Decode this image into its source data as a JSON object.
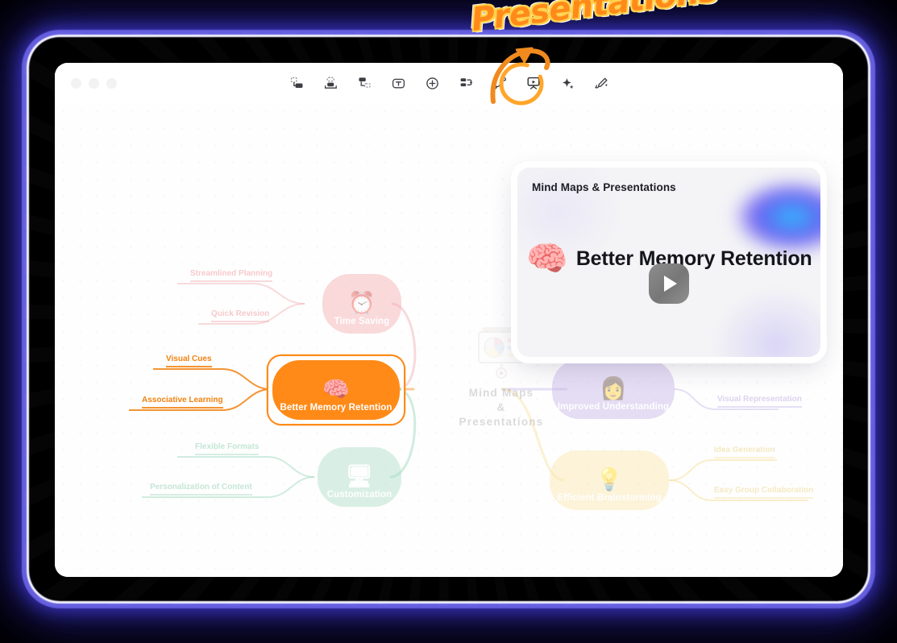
{
  "annotation": {
    "callout_text": "Presentations",
    "arrow": "curved-arrow-pointing-to-presentation-tool",
    "highlight_color": "#FF9B20"
  },
  "window": {
    "traffic_lights": [
      "close",
      "minimize",
      "maximize"
    ],
    "toolbar": {
      "items": [
        {
          "name": "layout-right-icon",
          "label": "Right Layout"
        },
        {
          "name": "layout-bottom-icon",
          "label": "Bottom Layout"
        },
        {
          "name": "tree-layout-icon",
          "label": "Tree Layout"
        },
        {
          "name": "text-icon",
          "label": "Text"
        },
        {
          "name": "add-node-icon",
          "label": "Add"
        },
        {
          "name": "outline-icon",
          "label": "Outline"
        },
        {
          "name": "relationship-icon",
          "label": "Relationship"
        },
        {
          "name": "presentation-icon",
          "label": "Presentation",
          "selected": true
        },
        {
          "name": "ai-sparkle-icon",
          "label": "AI Assistant"
        },
        {
          "name": "magic-brush-icon",
          "label": "Style Brush"
        }
      ]
    }
  },
  "presentation_card": {
    "title": "Mind Maps & Presentations",
    "slide_emoji": "brain-in-hands",
    "slide_heading": "Better Memory Retention",
    "play_button": "play"
  },
  "mindmap": {
    "root": {
      "label_lines": [
        "Mind Maps",
        "&",
        "Presentations"
      ],
      "icon": "presentation-board-pie-chart-icon"
    },
    "branches": [
      {
        "name": "time-saving",
        "label": "Time Saving",
        "emoji": "clock",
        "color": "#F6A8AC",
        "text_color": "#FFFFFF",
        "line_color": "#F2B0B4",
        "selected": false,
        "children": [
          "Streamlined Planning",
          "Quick Revision"
        ]
      },
      {
        "name": "better-memory-retention",
        "label": "Better Memory Retention",
        "emoji": "brain-in-hands",
        "color": "#FF8A18",
        "text_color": "#FFFFFF",
        "line_color": "#F39433",
        "selected": true,
        "children": [
          "Visual Cues",
          "Associative Learning"
        ]
      },
      {
        "name": "customization",
        "label": "Customization",
        "emoji": "settings-panel",
        "color": "#A8DCC3",
        "text_color": "#FFFFFF",
        "line_color": "#A9DCC4",
        "selected": false,
        "children": [
          "Flexible Formats",
          "Personalization of Content"
        ]
      },
      {
        "name": "improved-understanding",
        "label": "Improved Understanding",
        "emoji": "person-with-idea",
        "color": "#C3B2E8",
        "text_color": "#FFFFFF",
        "line_color": "#C8BAEA",
        "selected": false,
        "children": [
          "Visual Representation"
        ]
      },
      {
        "name": "efficient-brainstorming",
        "label": "Efficient Brainstorming",
        "emoji": "brainstorm-cloud",
        "color": "#FAE6A8",
        "text_color": "#FFFFFF",
        "line_color": "#F7E3A6",
        "selected": false,
        "children": [
          "Idea Generation",
          "Easy Group Collaboration"
        ]
      }
    ]
  }
}
